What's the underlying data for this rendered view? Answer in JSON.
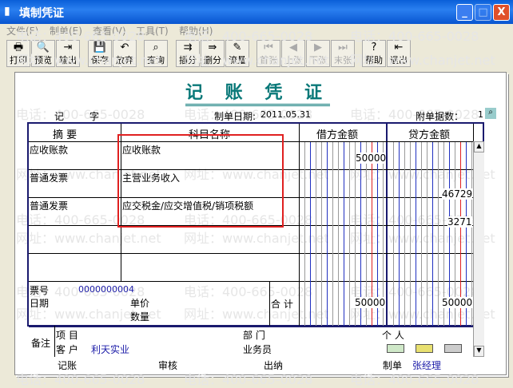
{
  "window": {
    "title": "填制凭证",
    "min": "_",
    "max": "□",
    "close": "X"
  },
  "menu": [
    "文件(F)",
    "制单(E)",
    "查看(V)",
    "工具(T)",
    "帮助(H)"
  ],
  "toolbar": [
    {
      "label": "打印",
      "icon": "printer-icon",
      "glyph": "🖶",
      "enabled": true
    },
    {
      "label": "预览",
      "icon": "preview-icon",
      "glyph": "🔍",
      "enabled": true
    },
    {
      "label": "输出",
      "icon": "export-icon",
      "glyph": "⇥",
      "enabled": true
    },
    {
      "label": "保存",
      "icon": "save-icon",
      "glyph": "💾",
      "enabled": true
    },
    {
      "label": "放弃",
      "icon": "undo-icon",
      "glyph": "↶",
      "enabled": true
    },
    {
      "label": "查询",
      "icon": "binoculars-icon",
      "glyph": "⌕",
      "enabled": true
    },
    {
      "label": "插分",
      "icon": "insert-row-icon",
      "glyph": "⇉",
      "enabled": true
    },
    {
      "label": "删分",
      "icon": "delete-row-icon",
      "glyph": "⇛",
      "enabled": true
    },
    {
      "label": "流量",
      "icon": "pencil-icon",
      "glyph": "✎",
      "enabled": true
    },
    {
      "label": "首张",
      "icon": "first-icon",
      "glyph": "⏮",
      "enabled": false
    },
    {
      "label": "上张",
      "icon": "prev-icon",
      "glyph": "◀",
      "enabled": false
    },
    {
      "label": "下张",
      "icon": "next-icon",
      "glyph": "▶",
      "enabled": false
    },
    {
      "label": "末张",
      "icon": "last-icon",
      "glyph": "⏭",
      "enabled": false
    },
    {
      "label": "帮助",
      "icon": "help-icon",
      "glyph": "?",
      "enabled": true
    },
    {
      "label": "退出",
      "icon": "exit-icon",
      "glyph": "⇤",
      "enabled": true
    }
  ],
  "watermark": {
    "phone": "电话：400-665-0028",
    "site": "网址：www.chanjet.net"
  },
  "voucher": {
    "title": "记 账 凭 证",
    "type": "记",
    "type_suffix": "字",
    "date_label": "制单日期:",
    "date": "2011.05.31",
    "attach_label": "附单据数：",
    "attach_count": "1",
    "headers": {
      "summary": "摘 要",
      "account": "科目名称",
      "debit": "借方金额",
      "credit": "贷方金额"
    },
    "rows": [
      {
        "summary": "应收账款",
        "account": "应收账款",
        "debit": "50000",
        "credit": ""
      },
      {
        "summary": "普通发票",
        "account": "主营业务收入",
        "debit": "",
        "credit": "46729"
      },
      {
        "summary": "普通发票",
        "account": "应交税金/应交增值税/销项税额",
        "debit": "",
        "credit": "3271"
      },
      {
        "summary": "",
        "account": "",
        "debit": "",
        "credit": ""
      },
      {
        "summary": "",
        "account": "",
        "debit": "",
        "credit": ""
      }
    ],
    "ticket_label": "票号",
    "ticket_no": "0000000004",
    "date_row_label": "日期",
    "price_label": "单价",
    "qty_label": "数量",
    "total_label": "合 计",
    "total_debit": "50000",
    "total_credit": "50000",
    "remarks_label": "备注",
    "project_label": "项 目",
    "dept_label": "部 门",
    "person_label": "个 人",
    "customer_label": "客 户",
    "customer": "利天实业",
    "salesman_label": "业务员",
    "sign": {
      "bookkeep": "记账",
      "review": "审核",
      "cashier": "出纳",
      "maker_label": "制单",
      "maker": "张经理"
    }
  }
}
